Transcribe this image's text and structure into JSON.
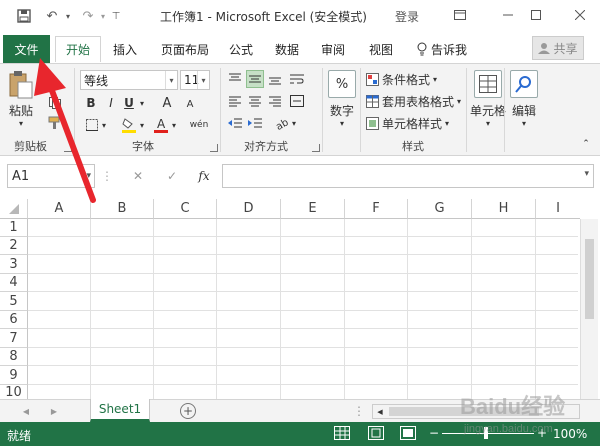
{
  "window": {
    "title": "工作簿1  -  Microsoft Excel (安全模式)",
    "login": "登录",
    "qat": [
      "save-icon",
      "undo-icon",
      "redo-icon",
      "customize-icon"
    ]
  },
  "tabs": [
    {
      "label": "文件",
      "kind": "file"
    },
    {
      "label": "开始",
      "kind": "active"
    },
    {
      "label": "插入"
    },
    {
      "label": "页面布局"
    },
    {
      "label": "公式"
    },
    {
      "label": "数据"
    },
    {
      "label": "审阅"
    },
    {
      "label": "视图"
    },
    {
      "label": "告诉我"
    }
  ],
  "share": {
    "label": "共享"
  },
  "ribbon": {
    "clipboard": {
      "paste": "粘贴",
      "group": "剪贴板"
    },
    "font": {
      "name": "等线",
      "size": "11",
      "group": "字体",
      "bold": "B",
      "italic": "I",
      "underline": "U",
      "grow": "A",
      "shrink": "A",
      "phonetic": "wén"
    },
    "alignment": {
      "group": "对齐方式"
    },
    "number": {
      "label": "数字",
      "icon": "%"
    },
    "styles": {
      "conditional": "条件格式",
      "table": "套用表格格式",
      "cell": "单元格样式",
      "group": "样式"
    },
    "cells": {
      "label": "单元格"
    },
    "editing": {
      "label": "编辑"
    }
  },
  "formula_bar": {
    "namebox": "A1",
    "cancel": "✕",
    "enter": "✓",
    "fx": "fx",
    "value": ""
  },
  "grid": {
    "columns": [
      "A",
      "B",
      "C",
      "D",
      "E",
      "F",
      "G",
      "H",
      "I"
    ],
    "rows": [
      "1",
      "2",
      "3",
      "4",
      "5",
      "6",
      "7",
      "8",
      "9",
      "10"
    ]
  },
  "sheets": {
    "active": "Sheet1",
    "add": "+"
  },
  "status": {
    "ready": "就绪",
    "zoom": "100%"
  },
  "watermark": {
    "text": "Baidu经验",
    "url": "jingyan.baidu.com"
  },
  "colors": {
    "accent": "#217346",
    "annotation": "#e8262d"
  }
}
